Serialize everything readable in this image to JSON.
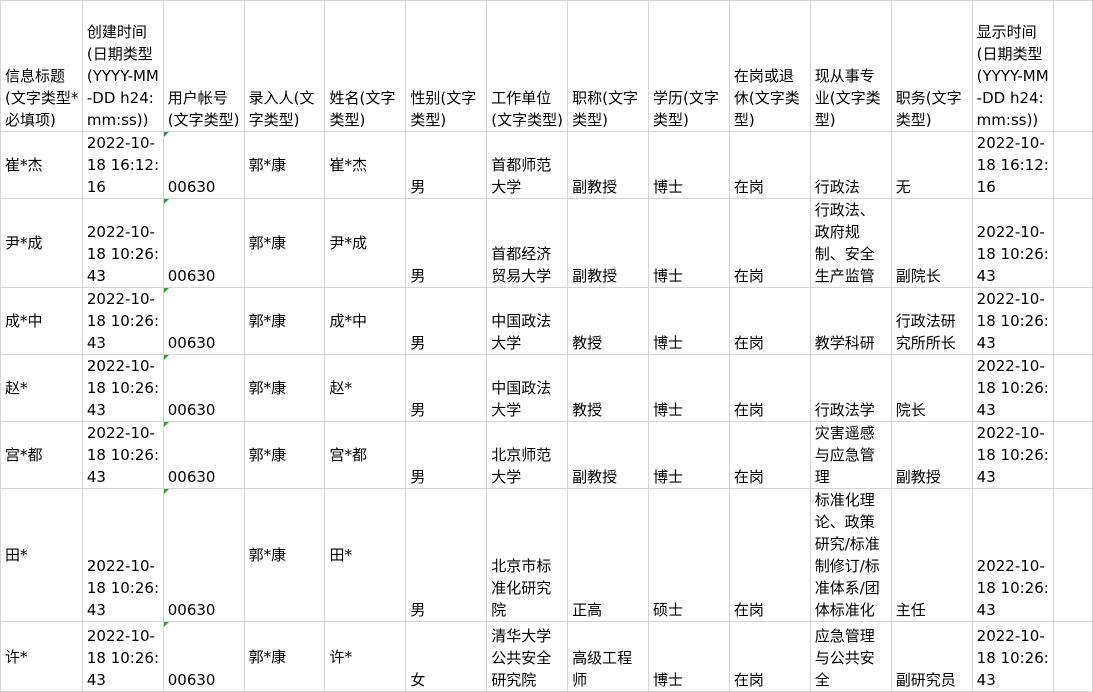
{
  "headers": [
    "信息标题(文字类型*必填项)",
    "创建时间(日期类型(YYYY-MM-DD h24:mm:ss))",
    "用户帐号(文字类型)",
    "录入人(文字类型)",
    "姓名(文字类型)",
    "性别(文字类型)",
    "工作单位(文字类型)",
    "职称(文字类型)",
    "学历(文字类型)",
    "在岗或退休(文字类型)",
    "现从事专业(文字类型)",
    "职务(文字类型)",
    "显示时间(日期类型(YYYY-MM-DD h24:mm:ss))"
  ],
  "rows": [
    [
      "崔*杰",
      "2022-10-18 16:12:16",
      "00630",
      "郭*康",
      "崔*杰",
      "男",
      "首都师范大学",
      "副教授",
      "博士",
      "在岗",
      "行政法",
      "无",
      "2022-10-18 16:12:16"
    ],
    [
      "尹*成",
      "2022-10-18 10:26:43",
      "00630",
      "郭*康",
      "尹*成",
      "男",
      "首都经济贸易大学",
      "副教授",
      "博士",
      "在岗",
      "行政法、政府规制、安全生产监管",
      "副院长",
      "2022-10-18 10:26:43"
    ],
    [
      "成*中",
      "2022-10-18 10:26:43",
      "00630",
      "郭*康",
      "成*中",
      "男",
      "中国政法大学",
      "教授",
      "博士",
      "在岗",
      "教学科研",
      "行政法研究所所长",
      "2022-10-18 10:26:43"
    ],
    [
      "赵*",
      "2022-10-18 10:26:43",
      "00630",
      "郭*康",
      "赵*",
      "男",
      "中国政法大学",
      "教授",
      "博士",
      "在岗",
      "行政法学",
      "院长",
      "2022-10-18 10:26:43"
    ],
    [
      "宫*都",
      "2022-10-18 10:26:43",
      "00630",
      "郭*康",
      "宫*都",
      "男",
      "北京师范大学",
      "副教授",
      "博士",
      "在岗",
      "灾害遥感与应急管理",
      "副教授",
      "2022-10-18 10:26:43"
    ],
    [
      "田*",
      "2022-10-18 10:26:43",
      "00630",
      "郭*康",
      "田*",
      "男",
      "北京市标准化研究院",
      "正高",
      "硕士",
      "在岗",
      "标准化理论、政策研究/标准制修订/标准体系/团体标准化",
      "主任",
      "2022-10-18 10:26:43"
    ],
    [
      "许*",
      "2022-10-18 10:26:43",
      "00630",
      "郭*康",
      "许*",
      "女",
      "清华大学公共安全研究院",
      "高级工程师",
      "博士",
      "在岗",
      "应急管理与公共安全",
      "副研究员",
      "2022-10-18 10:26:43"
    ]
  ]
}
